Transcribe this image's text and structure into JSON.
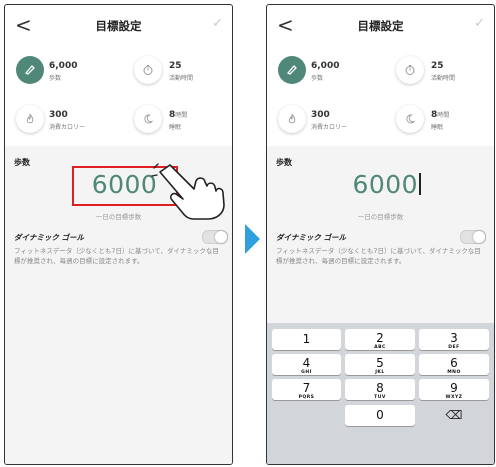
{
  "screens": [
    {
      "header": {
        "back": "<",
        "title": "目標設定",
        "done": "✓"
      },
      "stats": [
        {
          "value": "6,000",
          "unit": "",
          "label": "歩数",
          "icon": "shoe-icon",
          "active": true
        },
        {
          "value": "25",
          "unit": "",
          "label": "活動時間",
          "icon": "timer-icon",
          "active": false
        },
        {
          "value": "300",
          "unit": "",
          "label": "消費カロリー",
          "icon": "flame-icon",
          "active": false
        },
        {
          "value": "8",
          "unit": "時間",
          "label": "睡眠",
          "icon": "moon-icon",
          "active": false
        }
      ],
      "section_label": "歩数",
      "step_value": "6000",
      "step_caption": "一日の目標歩数",
      "dynamic_label": "ダイナミック ゴール",
      "dynamic_on": false,
      "dynamic_desc": "フィットネスデータ（少なくとも7日）に基づいて、ダイナミックな目標が推奨され、毎週の目標に設定されます。"
    },
    {
      "header": {
        "back": "<",
        "title": "目標設定",
        "done": "✓"
      },
      "stats": [
        {
          "value": "6,000",
          "unit": "",
          "label": "歩数",
          "icon": "shoe-icon",
          "active": true
        },
        {
          "value": "25",
          "unit": "",
          "label": "活動時間",
          "icon": "timer-icon",
          "active": false
        },
        {
          "value": "300",
          "unit": "",
          "label": "消費カロリー",
          "icon": "flame-icon",
          "active": false
        },
        {
          "value": "8",
          "unit": "時間",
          "label": "睡眠",
          "icon": "moon-icon",
          "active": false
        }
      ],
      "section_label": "歩数",
      "step_value": "6000",
      "step_caption": "一日の目標歩数",
      "dynamic_label": "ダイナミック ゴール",
      "dynamic_on": false,
      "dynamic_desc": "フィットネスデータ（少なくとも7日）に基づいて、ダイナミックな目標が推奨され、毎週の目標に設定されます。",
      "keypad": [
        {
          "num": "1",
          "letters": ""
        },
        {
          "num": "2",
          "letters": "ABC"
        },
        {
          "num": "3",
          "letters": "DEF"
        },
        {
          "num": "4",
          "letters": "GHI"
        },
        {
          "num": "5",
          "letters": "JKL"
        },
        {
          "num": "6",
          "letters": "MNO"
        },
        {
          "num": "7",
          "letters": "PQRS"
        },
        {
          "num": "8",
          "letters": "TUV"
        },
        {
          "num": "9",
          "letters": "WXYZ"
        },
        {
          "num": "0",
          "letters": ""
        },
        {
          "num": "⌫",
          "letters": ""
        }
      ]
    }
  ],
  "colors": {
    "accent": "#4f8878",
    "highlight": "#e02020",
    "arrow": "#2f9fdd",
    "keypad_bg": "#d2d5da"
  }
}
